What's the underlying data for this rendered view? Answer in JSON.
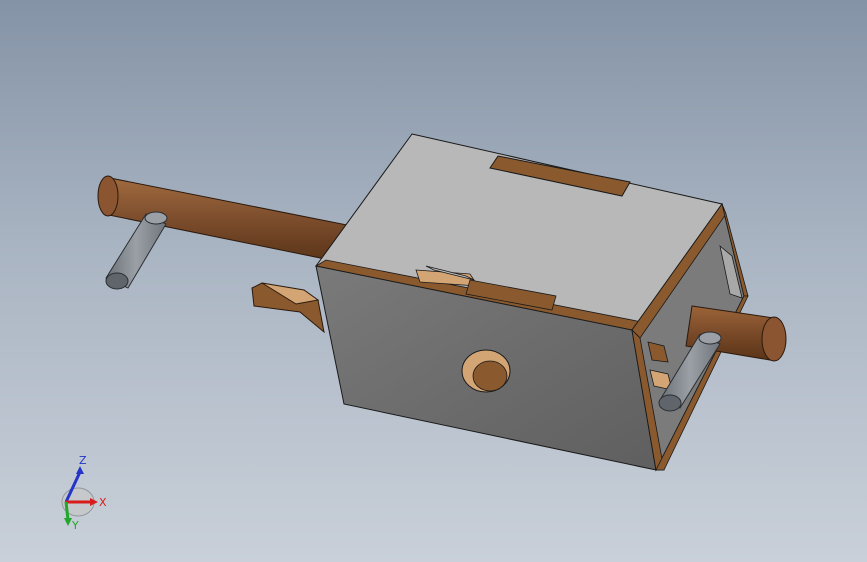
{
  "view": {
    "background_top": "#8493a6",
    "background_bottom": "#c9d0d9"
  },
  "model": {
    "colors": {
      "body_top": "#b7b7b7",
      "body_front": "#6d6d6d",
      "body_side": "#7a7a7a",
      "wood": "#8a5a2e",
      "wood_light": "#d8a873",
      "rod": "#7f4f2e",
      "pin": "#8a9096"
    }
  },
  "triad": {
    "z_label": "Z",
    "x_label": "X",
    "y_label": "Y",
    "colors": {
      "x": "#d81c1c",
      "y": "#1fa82a",
      "z": "#2235c8"
    }
  }
}
